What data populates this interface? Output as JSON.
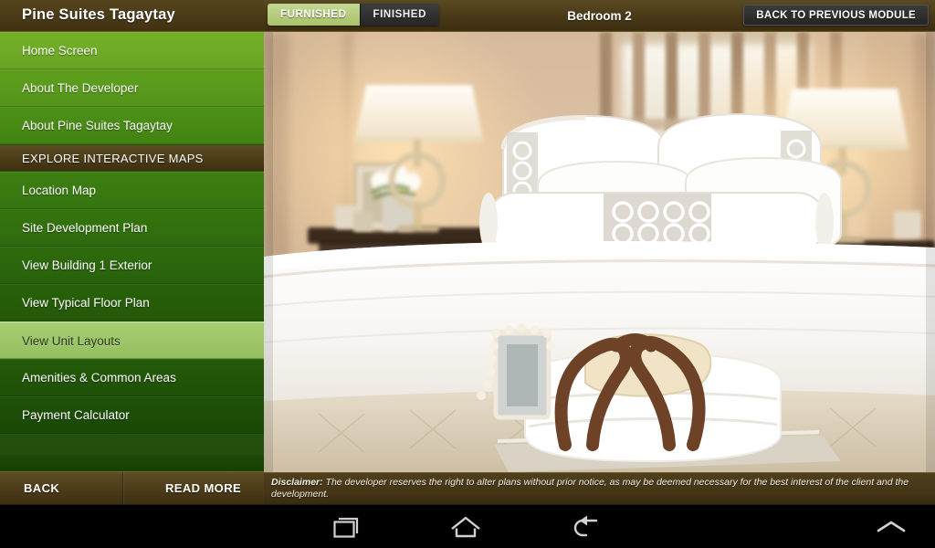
{
  "app": {
    "brand_title": "Pine Suites Tagaytay"
  },
  "sidebar": {
    "items": [
      {
        "label": "Home Screen",
        "type": "item",
        "selected": false
      },
      {
        "label": "About The Developer",
        "type": "item",
        "selected": false
      },
      {
        "label": "About Pine Suites Tagaytay",
        "type": "item",
        "selected": false
      },
      {
        "label": "EXPLORE INTERACTIVE MAPS",
        "type": "section",
        "selected": false
      },
      {
        "label": "Location Map",
        "type": "item",
        "selected": false
      },
      {
        "label": "Site Development Plan",
        "type": "item",
        "selected": false
      },
      {
        "label": "View Building 1 Exterior",
        "type": "item",
        "selected": false
      },
      {
        "label": "View Typical Floor Plan",
        "type": "item",
        "selected": false
      },
      {
        "label": "View Unit Layouts",
        "type": "item",
        "selected": true
      },
      {
        "label": "Amenities & Common Areas",
        "type": "item",
        "selected": false
      },
      {
        "label": "Payment Calculator",
        "type": "item",
        "selected": false
      }
    ],
    "footer": {
      "back_label": "BACK",
      "read_more_label": "READ MORE"
    }
  },
  "topbar": {
    "tabs": [
      {
        "label": "FURNISHED",
        "active": true
      },
      {
        "label": "FINISHED",
        "active": false
      }
    ],
    "room_title": "Bedroom 2",
    "back_module_label": "BACK TO PREVIOUS MODULE"
  },
  "photo": {
    "description": "Furnished bedroom interior with white bed, two table lamps, decorative pillows and a towel tray"
  },
  "disclaimer": {
    "label": "Disclaimer:",
    "text": " The developer reserves the right to alter plans without prior notice, as may be deemed necessary for the best interest of the client and the development."
  },
  "android_nav": {
    "recents_label": "recents-icon",
    "home_label": "home-icon",
    "back_label": "back-icon",
    "expand_label": "chevron-up-icon"
  },
  "colors": {
    "brand_brown": "#4a3a17",
    "sidebar_green_top": "#74b027",
    "sidebar_green_bottom": "#1a4806",
    "selected_green": "#a6cd74",
    "tab_active": "#b5cc7f",
    "tab_inactive": "#2b2b2b"
  }
}
